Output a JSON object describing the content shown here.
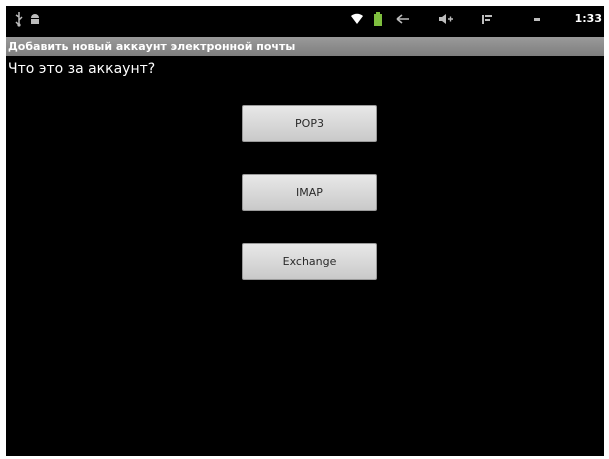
{
  "status_bar": {
    "time": "1:33",
    "icons": [
      "usb-icon",
      "android-icon",
      "wifi-icon",
      "battery-icon",
      "back-icon",
      "volume-up-icon",
      "volume-down-icon",
      "menu-icon",
      "home-icon"
    ]
  },
  "title_bar": {
    "title": "Добавить новый аккаунт электронной почты"
  },
  "main": {
    "question": "Что это за аккаунт?",
    "options": [
      {
        "label": "POP3"
      },
      {
        "label": "IMAP"
      },
      {
        "label": "Exchange"
      }
    ]
  },
  "colors": {
    "background": "#000000",
    "title_bar": "#8a8a8a",
    "button": "#d8d8d8",
    "text": "#ffffff"
  }
}
